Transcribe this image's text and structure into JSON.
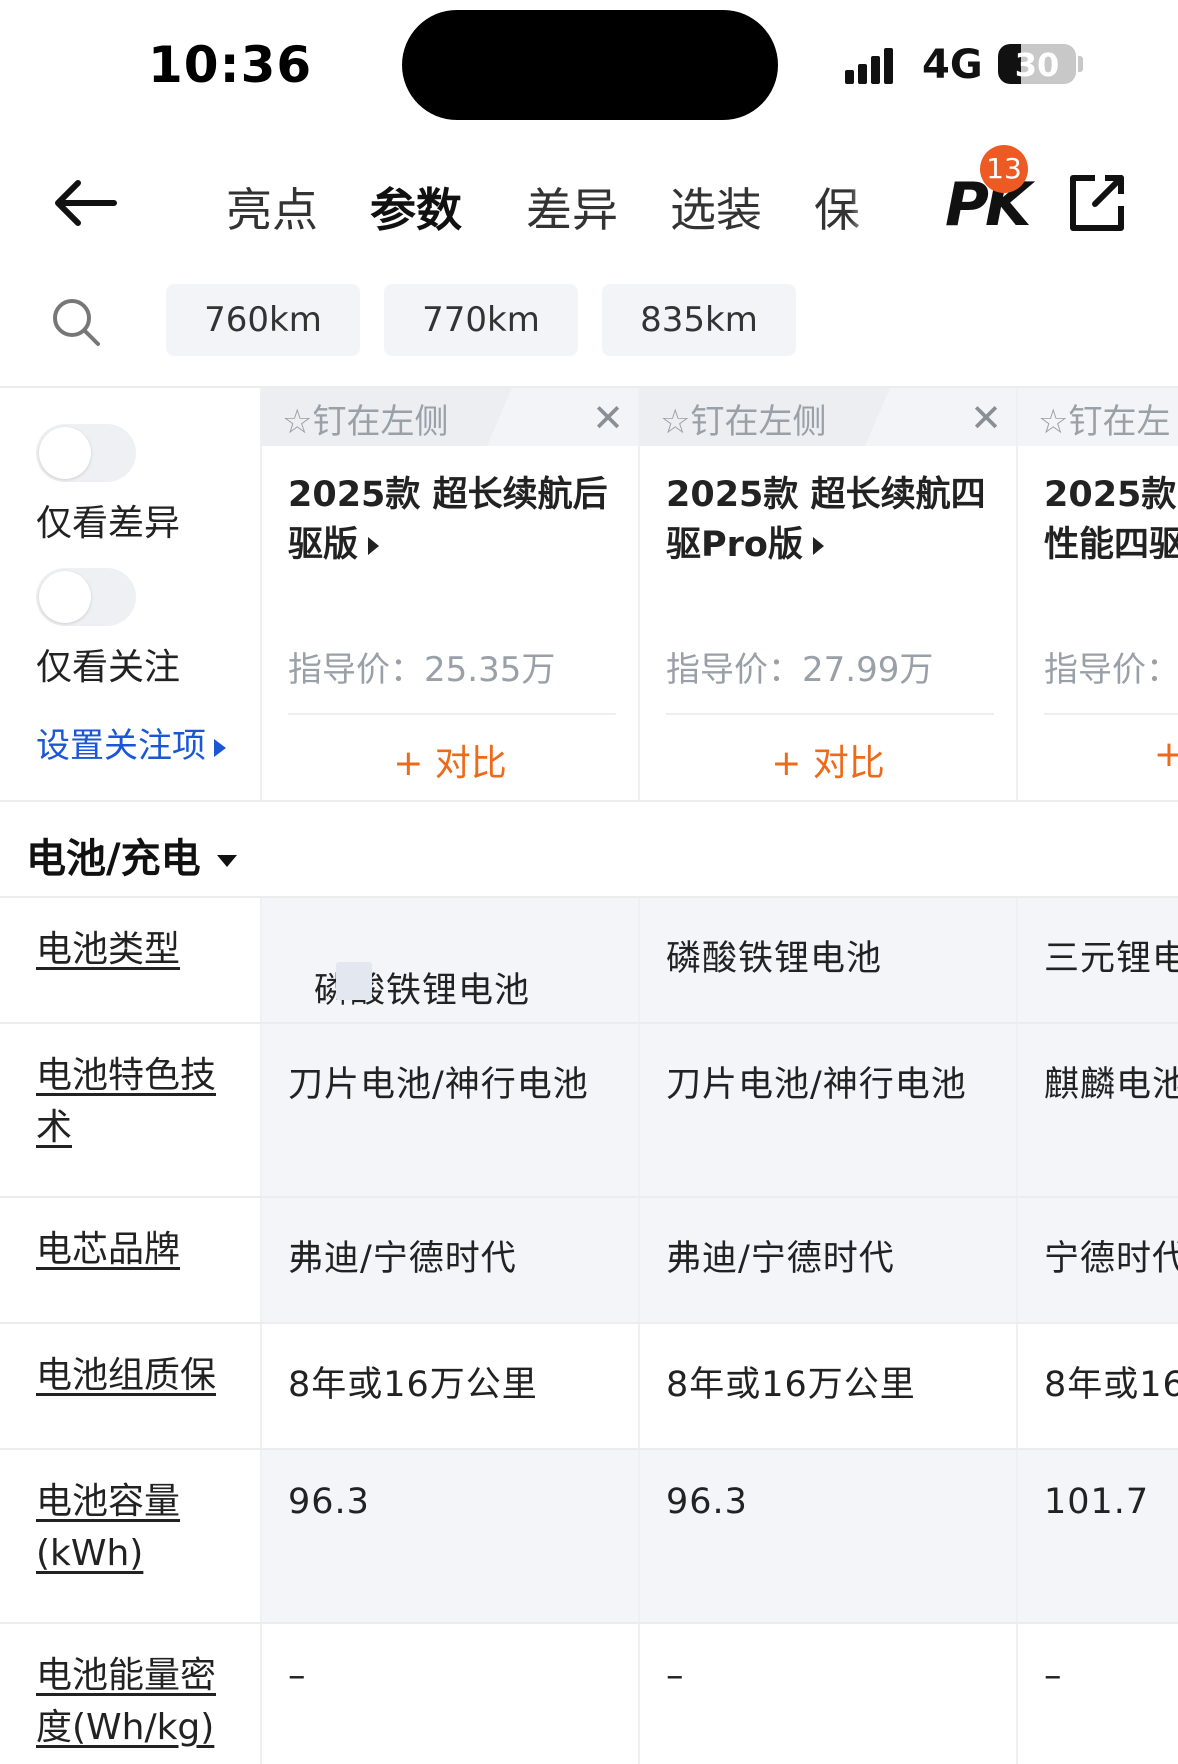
{
  "status_bar": {
    "time": "10:36",
    "network": "4G",
    "battery": "30",
    "battery_level": 0.3
  },
  "nav": {
    "tabs": [
      "亮点",
      "参数",
      "差异",
      "选装",
      "保"
    ],
    "active_tab": "参数",
    "pk_label": "PK",
    "pk_count": "13"
  },
  "versions": [
    "760km",
    "770km",
    "835km"
  ],
  "filters": {
    "only_diff": "仅看差异",
    "only_focus": "仅看关注",
    "set_focus": "设置关注项"
  },
  "cars": [
    {
      "pin": "钉在左侧",
      "name_line1": "2025款 超长续航后",
      "name_line2": "驱版",
      "price": "指导价：25.35万",
      "compare": "+ 对比"
    },
    {
      "pin": "钉在左侧",
      "name_line1": "2025款 超长续航四",
      "name_line2": "驱Pro版",
      "price": "指导价：27.99万",
      "compare": "+ 对比"
    },
    {
      "pin": "钉在左",
      "name_line1": "2025款",
      "name_line2": "性能四驱",
      "price": "指导价：",
      "compare": "+"
    }
  ],
  "section_title": "电池/充电",
  "params": [
    {
      "label": "电池类型",
      "values": [
        "磷酸铁锂电池",
        "磷酸铁锂电池",
        "三元锂电"
      ]
    },
    {
      "label": "电池特色技术",
      "values": [
        "刀片电池/神行电池",
        "刀片电池/神行电池",
        "麒麟电池"
      ]
    },
    {
      "label": "电芯品牌",
      "values": [
        "弗迪/宁德时代",
        "弗迪/宁德时代",
        "宁德时代"
      ]
    },
    {
      "label": "电池组质保",
      "values": [
        "8年或16万公里",
        "8年或16万公里",
        "8年或16"
      ]
    },
    {
      "label": "电池容量(kWh)",
      "values": [
        "96.3",
        "96.3",
        "101.7"
      ]
    },
    {
      "label": "电池能量密度(Wh/kg)",
      "values": [
        "–",
        "–",
        "–"
      ]
    }
  ],
  "colors": {
    "accent": "#ee6a1b",
    "link": "#1a56d6",
    "tab_highlight": "#f7d84a",
    "badge": "#ee5a24"
  }
}
